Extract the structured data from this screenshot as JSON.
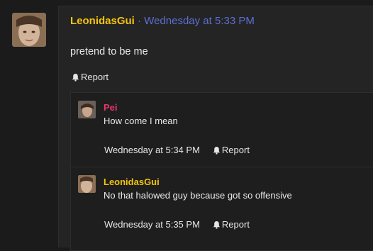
{
  "post": {
    "author": "LeonidasGui",
    "separator": "·",
    "timestamp": "Wednesday at 5:33 PM",
    "body": "pretend to be me",
    "report_label": "Report"
  },
  "replies": [
    {
      "author": "Pei",
      "text": "How come I mean",
      "timestamp": "Wednesday at 5:34 PM",
      "report_label": "Report"
    },
    {
      "author": "LeonidasGui",
      "text": "No that halowed guy because got so offensive",
      "timestamp": "Wednesday at 5:35 PM",
      "report_label": "Report"
    }
  ],
  "icons": {
    "report": "bell-icon"
  },
  "colors": {
    "username_gold": "#f2c40f",
    "username_pink": "#e8356a",
    "timestamp_blue": "#5b6fd1",
    "background": "#1b1b1b"
  }
}
